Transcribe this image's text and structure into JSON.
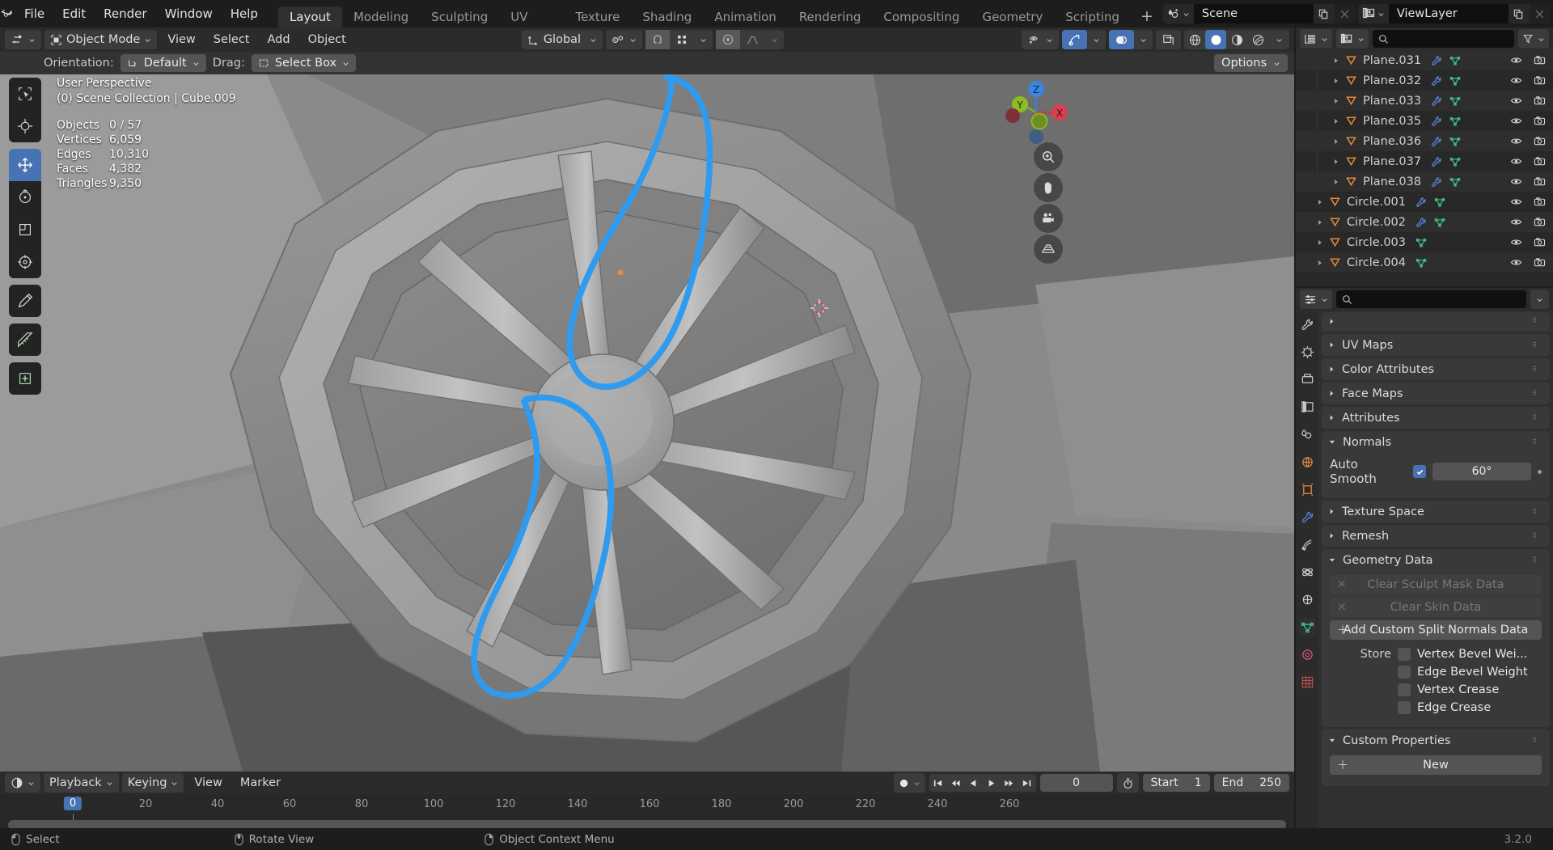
{
  "app": {
    "version": "3.2.0",
    "logo_icon": "blender-logo-icon"
  },
  "topbar": {
    "menus": [
      "File",
      "Edit",
      "Render",
      "Window",
      "Help"
    ],
    "workspace_tabs": [
      {
        "label": "Layout",
        "active": true
      },
      {
        "label": "Modeling",
        "active": false
      },
      {
        "label": "Sculpting",
        "active": false
      },
      {
        "label": "UV Editing",
        "active": false
      },
      {
        "label": "Texture Paint",
        "active": false
      },
      {
        "label": "Shading",
        "active": false
      },
      {
        "label": "Animation",
        "active": false
      },
      {
        "label": "Rendering",
        "active": false
      },
      {
        "label": "Compositing",
        "active": false
      },
      {
        "label": "Geometry Nodes",
        "active": false
      },
      {
        "label": "Scripting",
        "active": false
      }
    ],
    "add_workspace_label": "+",
    "scene_name": "Scene",
    "viewlayer_name": "ViewLayer"
  },
  "viewport_header": {
    "editor_type_icon": "editor-type-icon",
    "mode": "Object Mode",
    "menus": [
      "View",
      "Select",
      "Add",
      "Object"
    ],
    "transform_orientation": "Global",
    "snap_icon": "snapping-magnet-icon",
    "proportional_icon": "proportional-editing-icon",
    "visibility_icon": "object-visibility-icon",
    "gizmo_icon": "gizmo-icon",
    "overlays_icon": "overlays-icon",
    "xray_icon": "xray-toggle-icon",
    "shading_modes": [
      "wireframe",
      "solid",
      "material-preview",
      "rendered"
    ],
    "shading_active": "solid"
  },
  "tool_settings": {
    "orientation_label": "Orientation:",
    "orientation_value": "Default",
    "drag_label": "Drag:",
    "drag_value": "Select Box",
    "options_label": "Options"
  },
  "viewport_overlay": {
    "view_name": "User Perspective",
    "collection_line": "(0) Scene Collection | Cube.009",
    "stats": [
      {
        "key": "Objects",
        "value": "0 / 57"
      },
      {
        "key": "Vertices",
        "value": "6,059"
      },
      {
        "key": "Edges",
        "value": "10,310"
      },
      {
        "key": "Faces",
        "value": "4,382"
      },
      {
        "key": "Triangles",
        "value": "9,350"
      }
    ],
    "gizmo_axes": [
      "X",
      "Y",
      "Z"
    ],
    "annotation_color": "#2e9bf0"
  },
  "toolbar": {
    "tools": [
      {
        "name": "tool-select-box",
        "active": false
      },
      {
        "name": "tool-cursor",
        "active": false
      },
      {
        "name": "tool-move",
        "active": true
      },
      {
        "name": "tool-rotate",
        "active": false
      },
      {
        "name": "tool-scale",
        "active": false
      },
      {
        "name": "tool-transform",
        "active": false
      },
      {
        "name": "tool-annotate",
        "active": false
      },
      {
        "name": "tool-measure",
        "active": false
      },
      {
        "name": "tool-add-cube",
        "active": false
      }
    ]
  },
  "outliner": {
    "display_mode_icon": "outliner-display-mode-icon",
    "view_layer_icon": "view-layer-icon",
    "search_placeholder": "",
    "filter_icon": "filter-funnel-icon",
    "rows": [
      {
        "name": "Plane.031",
        "indent": 2,
        "modifier": true,
        "mesh": true
      },
      {
        "name": "Plane.032",
        "indent": 2,
        "modifier": true,
        "mesh": true
      },
      {
        "name": "Plane.033",
        "indent": 2,
        "modifier": true,
        "mesh": true
      },
      {
        "name": "Plane.035",
        "indent": 2,
        "modifier": true,
        "mesh": true
      },
      {
        "name": "Plane.036",
        "indent": 2,
        "modifier": true,
        "mesh": true
      },
      {
        "name": "Plane.037",
        "indent": 2,
        "modifier": true,
        "mesh": true
      },
      {
        "name": "Plane.038",
        "indent": 2,
        "modifier": true,
        "mesh": true
      },
      {
        "name": "Circle.001",
        "indent": 1,
        "modifier": true,
        "mesh": true
      },
      {
        "name": "Circle.002",
        "indent": 1,
        "modifier": true,
        "mesh": true
      },
      {
        "name": "Circle.003",
        "indent": 1,
        "modifier": false,
        "mesh": true
      },
      {
        "name": "Circle.004",
        "indent": 1,
        "modifier": false,
        "mesh": true
      }
    ]
  },
  "properties": {
    "search_placeholder": "",
    "tabs": [
      "tool-tab",
      "render-tab",
      "output-tab",
      "view-layer-tab",
      "scene-tab",
      "world-tab",
      "object-tab",
      "modifier-tab",
      "particles-tab",
      "physics-tab",
      "constraints-tab",
      "object-data-tab",
      "material-tab",
      "texture-tab"
    ],
    "active_tab": "object-data-tab",
    "panels": [
      {
        "label": "UV Maps",
        "open": false
      },
      {
        "label": "Color Attributes",
        "open": false
      },
      {
        "label": "Face Maps",
        "open": false
      },
      {
        "label": "Attributes",
        "open": false
      },
      {
        "label": "Normals",
        "open": true
      },
      {
        "label": "Texture Space",
        "open": false
      },
      {
        "label": "Remesh",
        "open": false
      },
      {
        "label": "Geometry Data",
        "open": true
      },
      {
        "label": "Custom Properties",
        "open": true
      }
    ],
    "normals": {
      "auto_smooth_label": "Auto Smooth",
      "auto_smooth_checked": true,
      "angle_value": "60°"
    },
    "geometry_data": {
      "clear_sculpt_mask_label": "Clear Sculpt Mask Data",
      "clear_skin_label": "Clear Skin Data",
      "add_custom_split_normals_label": "Add Custom Split Normals Data",
      "store_label": "Store",
      "store_options": [
        {
          "label": "Vertex Bevel Wei...",
          "checked": false
        },
        {
          "label": "Edge Bevel Weight",
          "checked": false
        },
        {
          "label": "Vertex Crease",
          "checked": false
        },
        {
          "label": "Edge Crease",
          "checked": false
        }
      ]
    },
    "custom_properties": {
      "new_label": "New"
    }
  },
  "timeline": {
    "editor_icon": "timeline-editor-icon",
    "menus": [
      "Playback",
      "Keying",
      "View",
      "Marker"
    ],
    "record_icon": "auto-keying-record-icon",
    "transport": [
      "jump-to-start",
      "prev-keyframe",
      "play-reverse",
      "play",
      "next-keyframe",
      "jump-to-end"
    ],
    "current_frame": "0",
    "use_preview_range_icon": "stopwatch-icon",
    "start_label": "Start",
    "start_value": "1",
    "end_label": "End",
    "end_value": "250",
    "ticks": [
      0,
      20,
      40,
      60,
      80,
      100,
      120,
      140,
      160,
      180,
      200,
      220,
      240,
      260
    ],
    "playhead_frame": "0"
  },
  "statusbar": {
    "items": [
      {
        "icon": "mouse-left-icon",
        "label": "Select"
      },
      {
        "icon": "mouse-middle-icon",
        "label": "Rotate View"
      },
      {
        "icon": "mouse-right-icon",
        "label": "Object Context Menu"
      }
    ],
    "version": "3.2.0"
  }
}
